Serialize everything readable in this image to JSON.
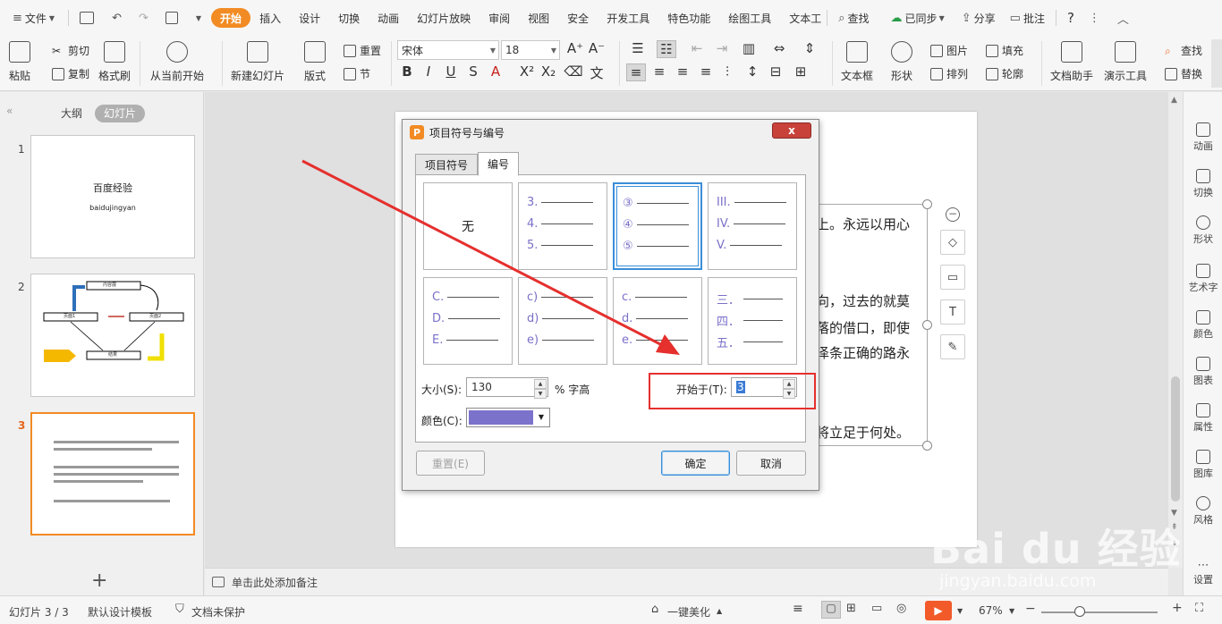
{
  "menubar": {
    "file": "文件",
    "tabs": [
      "开始",
      "插入",
      "设计",
      "切换",
      "动画",
      "幻灯片放映",
      "审阅",
      "视图",
      "安全",
      "开发工具",
      "特色功能",
      "绘图工具",
      "文本工"
    ],
    "active_tab": "开始",
    "search": "查找",
    "sync": "已同步",
    "share": "分享",
    "comment": "批注",
    "help": "?"
  },
  "ribbon": {
    "paste": "粘贴",
    "cut": "剪切",
    "copy": "复制",
    "format_painter": "格式刷",
    "from_current": "从当前开始",
    "new_slide": "新建幻灯片",
    "layout": "版式",
    "reset": "重置",
    "section": "节",
    "font_name": "宋体",
    "font_size": "18",
    "textbox": "文本框",
    "shape": "形状",
    "picture": "图片",
    "arrange": "排列",
    "fill": "填充",
    "outline": "轮廓",
    "doc_assistant": "文档助手",
    "presentation_tools": "演示工具",
    "find": "查找",
    "replace": "替换"
  },
  "left_panel": {
    "tab_outline": "大纲",
    "tab_slides": "幻灯片",
    "slides": [
      {
        "num": "1",
        "title": "百度经验",
        "subtitle": "baidujingyan"
      },
      {
        "num": "2",
        "nodes": [
          "内容展",
          "页面1",
          "页面2",
          "结果"
        ]
      },
      {
        "num": "3"
      }
    ],
    "active_slide": "3"
  },
  "slide": {
    "lines": [
      "上。永远以用心",
      "向，过去的就莫",
      "落的借口，即使",
      "泽条正确的路永",
      "将立足于何处。"
    ]
  },
  "dialog": {
    "title": "项目符号与编号",
    "close": "x",
    "tab_bullets": "项目符号",
    "tab_numbering": "编号",
    "none_label": "无",
    "styles": [
      [
        "3.",
        "4.",
        "5."
      ],
      [
        "③",
        "④",
        "⑤"
      ],
      [
        "III.",
        "IV.",
        "V."
      ],
      [
        "C.",
        "D.",
        "E."
      ],
      [
        "c)",
        "d)",
        "e)"
      ],
      [
        "c.",
        "d.",
        "e."
      ],
      [
        "三．",
        "四．",
        "五．"
      ]
    ],
    "size_label": "大小(S):",
    "size_value": "130",
    "size_unit": "% 字高",
    "start_label": "开始于(T):",
    "start_value": "3",
    "color_label": "颜色(C):",
    "color_value": "#7b72cc",
    "reset_button": "重置(E)",
    "ok_button": "确定",
    "cancel_button": "取消"
  },
  "notes": {
    "placeholder": "单击此处添加备注"
  },
  "right_sidebar": {
    "items": [
      "动画",
      "切换",
      "形状",
      "艺术字",
      "颜色",
      "图表",
      "属性",
      "图库",
      "风格",
      "设置"
    ]
  },
  "statusbar": {
    "slide_count": "幻灯片 3 / 3",
    "template": "默认设计模板",
    "protection": "文档未保护",
    "beautify": "一键美化",
    "zoom": "67%"
  },
  "watermark": {
    "brand": "Bai du 经验",
    "url": "jingyan.baidu.com"
  },
  "colors": {
    "accent": "#f28b24",
    "highlight_red": "#e5302e",
    "number_color": "#7a70c8",
    "play_button": "#f25a29"
  }
}
